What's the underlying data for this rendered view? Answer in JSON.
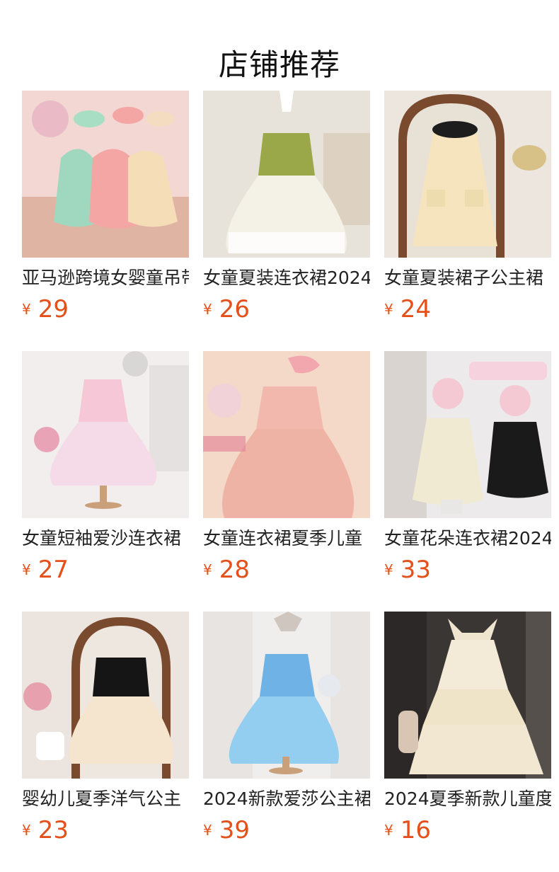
{
  "section": {
    "title": "店铺推荐"
  },
  "colors": {
    "price": "#e5501a",
    "title": "#111111",
    "text": "#222222"
  },
  "products": [
    {
      "name": "亚马逊跨境女婴童吊带",
      "currency": "¥",
      "price": "29",
      "image": "green-pink-beige-tutu-rompers-photo",
      "dress_color": "#f4a9a8",
      "bg_color": "#f2d7d2"
    },
    {
      "name": "女童夏装连衣裙2024",
      "currency": "¥",
      "price": "26",
      "image": "green-white-tulle-dress-photo",
      "dress_color": "#f3efe2",
      "bg_color": "#e7e2da"
    },
    {
      "name": "女童夏装裙子公主裙",
      "currency": "¥",
      "price": "24",
      "image": "cream-collar-dress-mirror-photo",
      "dress_color": "#f6e7c6",
      "bg_color": "#ece6de"
    },
    {
      "name": "女童短袖爱沙连衣裙",
      "currency": "¥",
      "price": "27",
      "image": "pink-princess-dress-mannequin-photo",
      "dress_color": "#f5d6e2",
      "bg_color": "#f2eeee"
    },
    {
      "name": "女童连衣裙夏季儿童",
      "currency": "¥",
      "price": "28",
      "image": "pink-feather-dress-photo",
      "dress_color": "#efb9ad",
      "bg_color": "#f4d9c8"
    },
    {
      "name": "女童花朵连衣裙2024",
      "currency": "¥",
      "price": "33",
      "image": "white-black-flower-dresses-kids-photo",
      "dress_color": "#f2ecd8",
      "bg_color": "#eceaea"
    },
    {
      "name": "婴幼儿夏季洋气公主",
      "currency": "¥",
      "price": "23",
      "image": "black-cream-tulle-dress-mirror-photo",
      "dress_color": "#f4e2cc",
      "bg_color": "#ebe4df"
    },
    {
      "name": "2024新款爱莎公主裙",
      "currency": "¥",
      "price": "39",
      "image": "blue-elsa-dress-mannequin-photo",
      "dress_color": "#8cc9ec",
      "bg_color": "#f0eeec"
    },
    {
      "name": "2024夏季新款儿童度",
      "currency": "¥",
      "price": "16",
      "image": "cream-tiered-slip-dress-photo",
      "dress_color": "#f1e8d3",
      "bg_color": "#3a3634"
    }
  ]
}
